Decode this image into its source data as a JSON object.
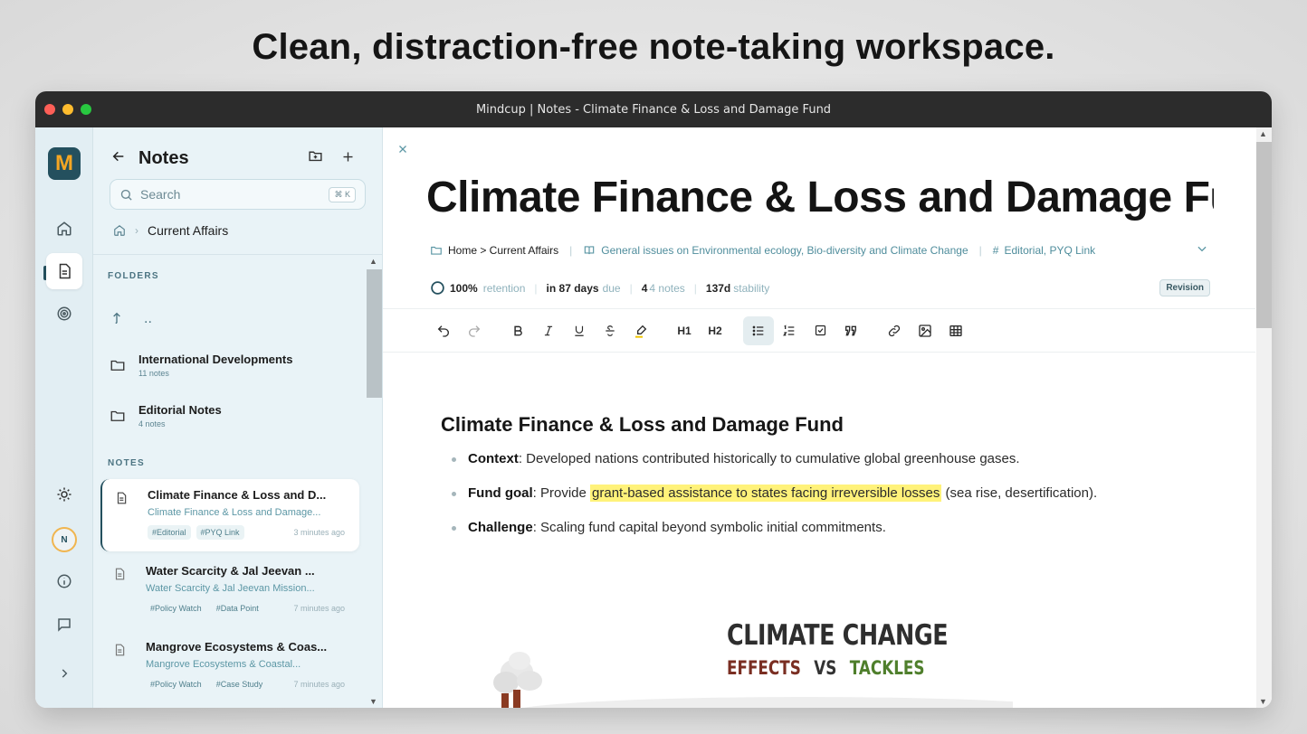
{
  "headline": "Clean, distraction-free note-taking workspace.",
  "window": {
    "title": "Mindcup | Notes - Climate Finance & Loss and Damage Fund"
  },
  "rail": {
    "logo": "M",
    "avatar": "N",
    "colors": {
      "logo_bg": "#24505e",
      "logo_fg": "#f5a623"
    }
  },
  "panel": {
    "title": "Notes",
    "search": {
      "placeholder": "Search",
      "shortcut": "⌘ K"
    },
    "breadcrumb": "Current Affairs",
    "folders_label": "FOLDERS",
    "up_label": "..",
    "folders": [
      {
        "name": "International Developments",
        "count": "11 notes"
      },
      {
        "name": "Editorial Notes",
        "count": "4 notes"
      }
    ],
    "notes_label": "NOTES",
    "notes": [
      {
        "title": "Climate Finance & Loss and D...",
        "subtitle": "Climate Finance & Loss and Damage...",
        "tags": [
          "#Editorial",
          "#PYQ Link"
        ],
        "time": "3 minutes ago"
      },
      {
        "title": "Water Scarcity & Jal Jeevan ...",
        "subtitle": "Water Scarcity & Jal Jeevan Mission...",
        "tags": [
          "#Policy Watch",
          "#Data Point"
        ],
        "time": "7 minutes ago"
      },
      {
        "title": "Mangrove Ecosystems & Coas...",
        "subtitle": "Mangrove Ecosystems & Coastal...",
        "tags": [
          "#Policy Watch",
          "#Case Study"
        ],
        "time": "7 minutes ago"
      }
    ]
  },
  "editor": {
    "title": "Climate Finance & Loss and Damage Fu",
    "path": "Home > Current Affairs",
    "topic": "General issues on Environmental ecology, Bio-diversity and Climate Change",
    "tags": "Editorial, PYQ Link",
    "stats": {
      "retention_value": "100%",
      "retention_label": "retention",
      "due_value": "in 87 days",
      "due_label": "due",
      "notes_value": "4",
      "notes_label": "4 notes",
      "stability_value": "137d",
      "stability_label": "stability",
      "badge": "Revision"
    },
    "toolbar": {
      "h1": "H1",
      "h2": "H2"
    },
    "heading": "Climate Finance & Loss and Damage Fund",
    "bullets": [
      {
        "label": "Context",
        "text": ": Developed nations contributed historically to cumulative global greenhouse gases."
      },
      {
        "label": "Fund goal",
        "pre": ": Provide ",
        "highlight": "grant-based assistance to states facing irreversible losses",
        "post": " (sea rise, desertification)."
      },
      {
        "label": "Challenge",
        "text": ": Scaling fund capital beyond symbolic initial commitments."
      }
    ],
    "image": {
      "title": "CLIMATE CHANGE",
      "effects": "EFFECTS",
      "vs": "VS",
      "tackles": "TACKLES"
    },
    "colors": {
      "highlight": "#fff27a",
      "accent": "#4f8d9c"
    }
  }
}
